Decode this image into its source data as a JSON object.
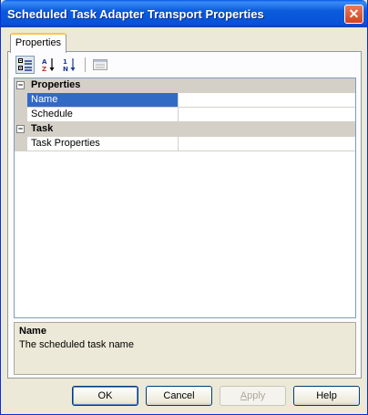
{
  "window": {
    "title": "Scheduled Task Adapter Transport Properties"
  },
  "tabs": [
    {
      "label": "Properties",
      "active": true
    }
  ],
  "toolbar": {
    "buttons": [
      {
        "name": "categorized-view",
        "icon": "categorized-icon",
        "pressed": true
      },
      {
        "name": "alphabetical-sort",
        "icon": "sort-az-icon",
        "pressed": false
      },
      {
        "name": "numeric-sort",
        "icon": "sort-1n-icon",
        "pressed": false
      },
      {
        "name": "property-pages",
        "icon": "property-pages-icon",
        "pressed": false
      }
    ]
  },
  "grid": {
    "categories": [
      {
        "label": "Properties",
        "expanded": true,
        "properties": [
          {
            "name": "Name",
            "value": "",
            "selected": true
          },
          {
            "name": "Schedule",
            "value": "",
            "selected": false
          }
        ]
      },
      {
        "label": "Task",
        "expanded": true,
        "properties": [
          {
            "name": "Task Properties",
            "value": "",
            "selected": false
          }
        ]
      }
    ]
  },
  "description": {
    "title": "Name",
    "text": "The scheduled task name"
  },
  "buttons": {
    "ok": "OK",
    "cancel": "Cancel",
    "apply_prefix": "",
    "apply_mnemonic": "A",
    "apply_rest": "pply",
    "help": "Help"
  },
  "colors": {
    "titlebar": "#0852d8",
    "selection": "#316ac5",
    "category_band": "#d4d0c8",
    "dialog_face": "#ece9d8",
    "close_button": "#d5431d"
  }
}
